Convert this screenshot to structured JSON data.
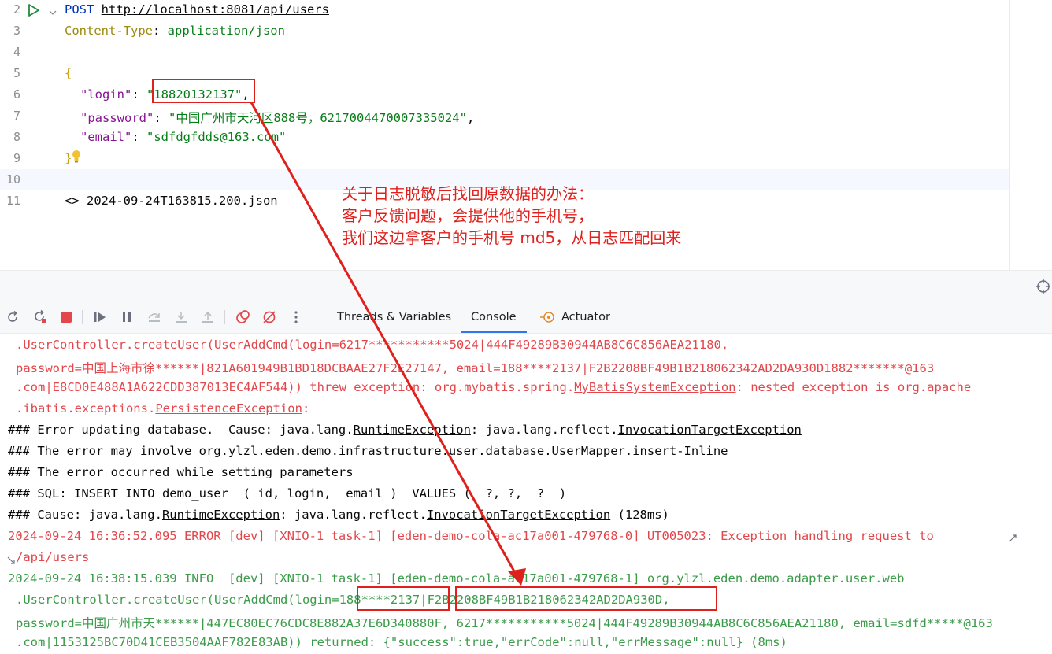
{
  "editor": {
    "gutter": [
      "2",
      "3",
      "4",
      "5",
      "6",
      "7",
      "8",
      "9",
      "10",
      "11"
    ],
    "request": {
      "method": "POST",
      "url": "http://localhost:8081/api/users",
      "header_name": "Content-Type",
      "header_sep": ": ",
      "header_value": "application/json"
    },
    "body": {
      "open_brace": "{",
      "login_key": "\"login\"",
      "login_value": "\"18820132137\"",
      "password_key": "\"password\"",
      "password_value": "\"中国广州市天河区888号，6217004470007335024\"",
      "email_key": "\"email\"",
      "email_value": "\"sdfdgfdds@163.com\"",
      "close_brace": "}"
    },
    "response_file": "<> 2024-09-24T163815.200.json"
  },
  "annotation": {
    "line1": "关于日志脱敏后找回原数据的办法：",
    "line2": "客户反馈问题，会提供他的手机号，",
    "line3": "我们这边拿客户的手机号 md5，从日志匹配回来"
  },
  "toolbar": {
    "tabs": [
      {
        "label": "Threads & Variables"
      },
      {
        "label": "Console"
      },
      {
        "label": "Actuator"
      }
    ],
    "icons": [
      "rerun-icon",
      "restart-icon",
      "stop-icon",
      "resume-icon",
      "pause-icon",
      "step-over-icon",
      "step-into-icon",
      "step-out-icon",
      "view-breakpoints-icon",
      "mute-breakpoints-icon",
      "more-icon"
    ]
  },
  "console": {
    "l1": ".UserController.createUser(UserAddCmd(login=6217***********5024|444F49289B30944AB8C6C856AEA21180,",
    "l2": "password=中国上海市徐******|821A601949B1BD18DCBAAE27F2E27147, email=188****2137|F2B2208BF49B1B218062342AD2DA930D1882*******@163",
    "l3a": ".com|E8CD0E488A1A622CDD387013EC4AF544)) threw exception: org.mybatis.spring.",
    "l3b": "MyBatisSystemException",
    "l3c": ": nested exception is org.apache",
    "l4a": ".ibatis.exceptions.",
    "l4b": "PersistenceException",
    "l4c": ":",
    "l5a": "### Error updating database.  Cause: java.lang.",
    "l5b": "RuntimeException",
    "l5c": ": java.lang.reflect.",
    "l5d": "InvocationTargetException",
    "l6": "### The error may involve org.ylzl.eden.demo.infrastructure.user.database.UserMapper.insert-Inline",
    "l7": "### The error occurred while setting parameters",
    "l8": "### SQL: INSERT INTO demo_user  ( id, login,  email )  VALUES (  ?, ?,  ?  )",
    "l9a": "### Cause: java.lang.",
    "l9b": "RuntimeException",
    "l9c": ": java.lang.reflect.",
    "l9d": "InvocationTargetException",
    "l9e": " (128ms)",
    "l10": "2024-09-24 16:36:52.095 ERROR [dev] [XNIO-1 task-1] [eden-demo-cola-ac17a001-479768-0] UT005023: Exception handling request to",
    "l11": "/api/users",
    "l12": "2024-09-24 16:38:15.039 INFO  [dev] [XNIO-1 task-1] [eden-demo-cola-ac17a001-479768-1] org.ylzl.eden.demo.adapter.user.web",
    "l13": ".UserController.createUser(UserAddCmd(login=188****2137|F2B2208BF49B1B218062342AD2DA930D,",
    "l14": "password=中国广州市天******|447EC80EC76CDC8E882A37E6D340880F, 6217***********5024|444F49289B30944AB8C6C856AEA21180, email=sdfd*****@163",
    "l15": ".com|1153125BC70D41CEB3504AAF782E83AB)) returned: {\"success\":true,\"errCode\":null,\"errMessage\":null} (8ms)"
  },
  "colors": {
    "annotation_red": "#e0201c",
    "error_text": "#e3464b",
    "info_text": "#3b9c4a",
    "active_tab": "#3574f0"
  }
}
